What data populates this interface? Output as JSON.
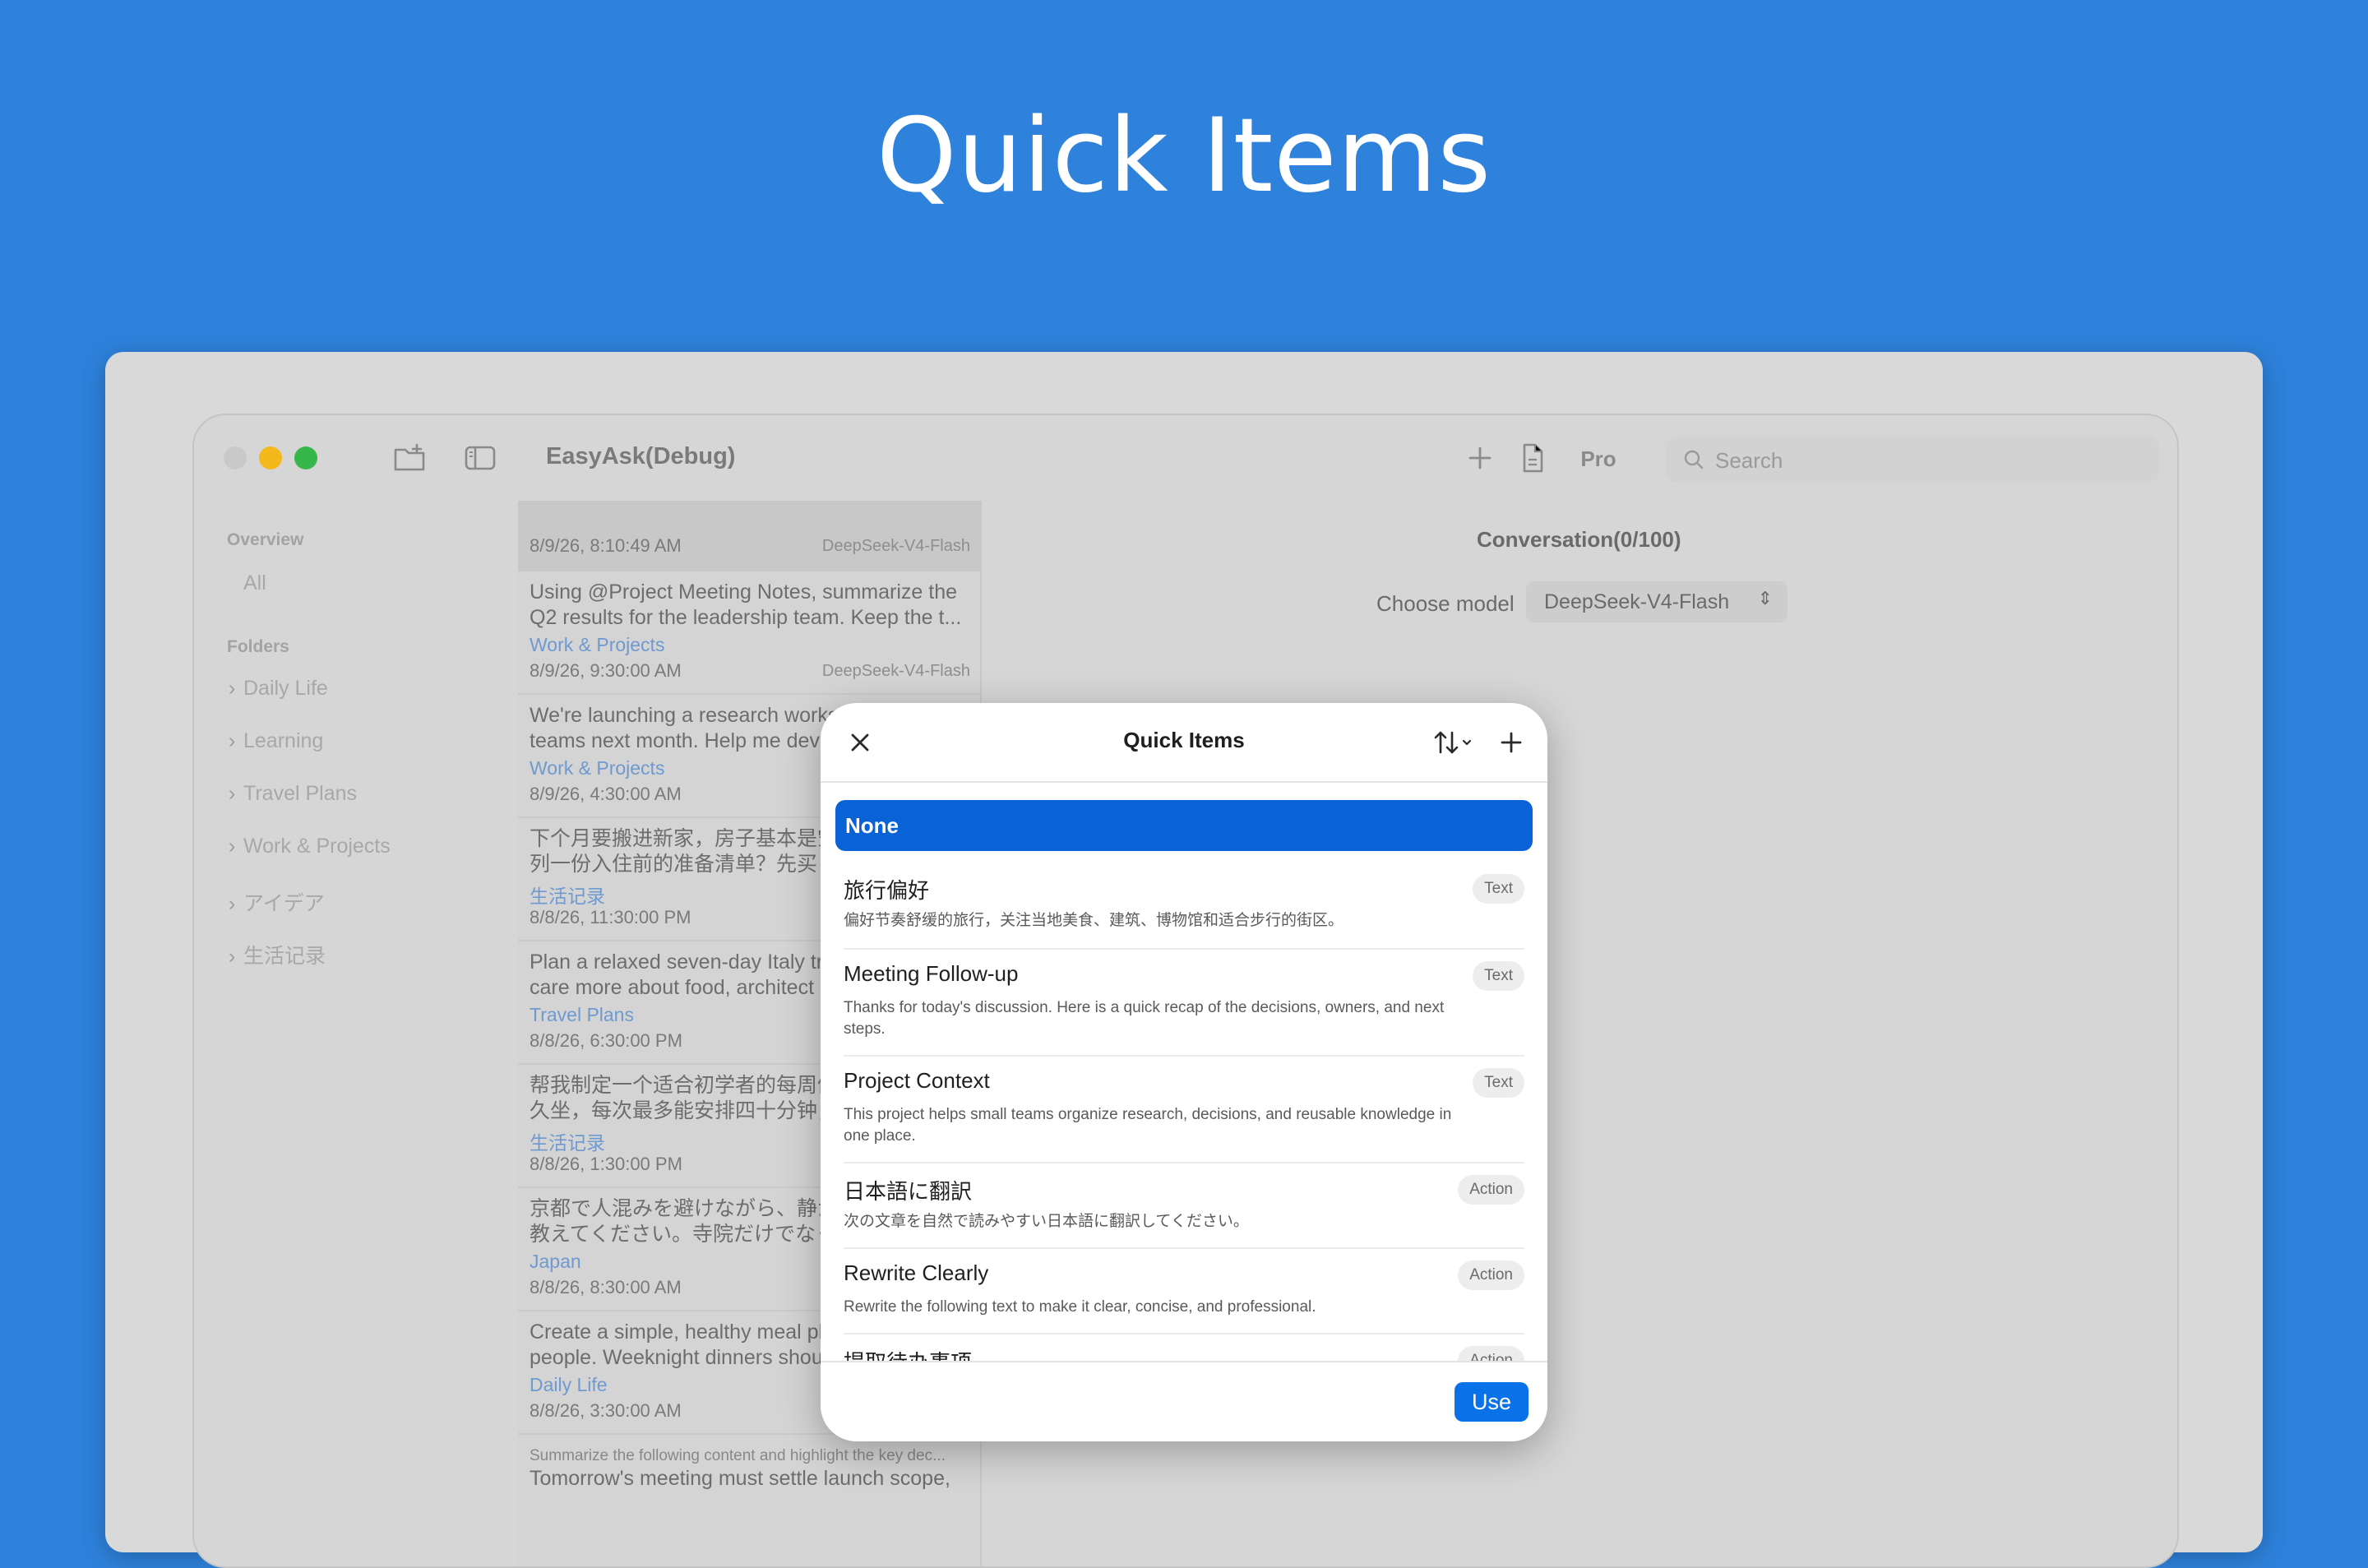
{
  "hero": {
    "title": "Quick Items"
  },
  "app": {
    "title": "EasyAsk(Debug)",
    "pro_label": "Pro",
    "search_placeholder": "Search"
  },
  "sidebar": {
    "overview_label": "Overview",
    "all_label": "All",
    "folders_label": "Folders",
    "folders": [
      "Daily Life",
      "Learning",
      "Travel Plans",
      "Work & Projects",
      "アイデア",
      "生活记录"
    ]
  },
  "conversations": [
    {
      "text1": "",
      "text2": "",
      "folder": "",
      "date": "8/9/26, 8:10:49 AM",
      "model": "DeepSeek-V4-Flash"
    },
    {
      "text1": "Using @Project Meeting Notes, summarize the",
      "text2": "Q2 results for the leadership team. Keep the t...",
      "folder": "Work & Projects",
      "date": "8/9/26, 9:30:00 AM",
      "model": "DeepSeek-V4-Flash"
    },
    {
      "text1": "We're launching a research works",
      "text2": "teams next month. Help me deve",
      "folder": "Work & Projects",
      "date": "8/9/26, 4:30:00 AM",
      "model": ""
    },
    {
      "text1": "下个月要搬进新家，房子基本是空",
      "text2": "列一份入住前的准备清单？先买",
      "folder": "生活记录",
      "date": "8/8/26, 11:30:00 PM",
      "model": ""
    },
    {
      "text1": "Plan a relaxed seven-day Italy tr",
      "text2": "care more about food, architect",
      "folder": "Travel Plans",
      "date": "8/8/26, 6:30:00 PM",
      "model": ""
    },
    {
      "text1": "帮我制定一个适合初学者的每周健",
      "text2": "久坐，每次最多能安排四十分钟，",
      "folder": "生活记录",
      "date": "8/8/26, 1:30:00 PM",
      "model": ""
    },
    {
      "text1": "京都で人混みを避けながら、静かに",
      "text2": "教えてください。寺院だけでなく、",
      "folder": "Japan",
      "date": "8/8/26, 8:30:00 AM",
      "model": ""
    },
    {
      "text1": "Create a simple, healthy meal pl",
      "text2": "people. Weeknight dinners shou",
      "folder": "Daily Life",
      "date": "8/8/26, 3:30:00 AM",
      "model": ""
    },
    {
      "text1": "Summarize the following content and highlight the key dec...",
      "text2": "Tomorrow's meeting must settle launch scope,",
      "folder": "",
      "date": "",
      "model": ""
    }
  ],
  "detail": {
    "conversation_title": "Conversation(0/100)",
    "choose_model_label": "Choose model",
    "selected_model": "DeepSeek-V4-Flash"
  },
  "dialog": {
    "title": "Quick Items",
    "none_label": "None",
    "use_label": "Use",
    "items": [
      {
        "title": "旅行偏好",
        "badge": "Text",
        "desc": "偏好节奏舒缓的旅行，关注当地美食、建筑、博物馆和适合步行的街区。"
      },
      {
        "title": "Meeting Follow-up",
        "badge": "Text",
        "desc": "Thanks for today's discussion. Here is a quick recap of the decisions, owners, and next steps."
      },
      {
        "title": "Project Context",
        "badge": "Text",
        "desc": "This project helps small teams organize research, decisions, and reusable knowledge in one place."
      },
      {
        "title": "日本語に翻訳",
        "badge": "Action",
        "desc": "次の文章を自然で読みやすい日本語に翻訳してください。"
      },
      {
        "title": "Rewrite Clearly",
        "badge": "Action",
        "desc": "Rewrite the following text to make it clear, concise, and professional."
      },
      {
        "title": "提取待办事项",
        "badge": "Action",
        "desc": ""
      }
    ]
  },
  "colors": {
    "background": "#2e82dc",
    "accent": "#0a63d6",
    "folder_link": "#6f9ad0"
  }
}
